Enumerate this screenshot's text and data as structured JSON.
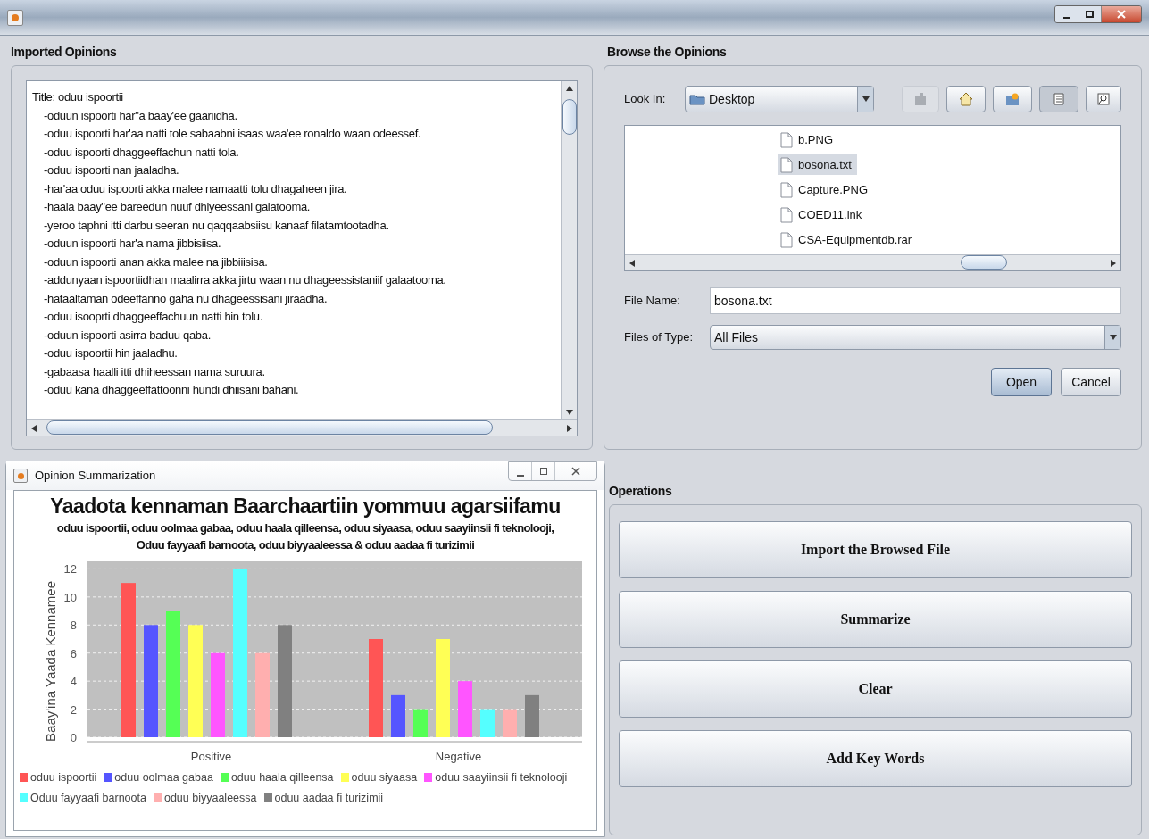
{
  "imported_opinions": {
    "title": "Imported Opinions",
    "heading": "Title: oduu ispoortii",
    "lines": [
      "-oduun ispoorti har\"a baay'ee gaariidha.",
      "-oduu ispoorti har'aa natti tole sabaabni isaas waa'ee ronaldo waan odeessef.",
      "-oduu ispoorti dhaggeeffachun natti tola.",
      "-oduu ispoorti nan jaaladha.",
      "-har'aa oduu ispoorti akka malee namaatti tolu dhagaheen jira.",
      "-haala baay\"ee bareedun nuuf dhiyeessani galatooma.",
      "-yeroo taphni itti darbu seeran nu qaqqaabsiisu kanaaf filatamtootadha.",
      "-oduun ispoorti har'a nama jibbisiisa.",
      "-oduun ispoorti anan akka malee na jibbiiisisa.",
      "-addunyaan ispoortiidhan maalirra akka jirtu waan nu dhageessistaniif galaatooma.",
      "-hataaltaman odeeffanno gaha nu dhageessisani jiraadha.",
      "-oduu isooprti dhaggeeffachuun natti hin tolu.",
      "-oduun ispoorti asirra baduu qaba.",
      "-oduu ispoortii hin jaaladhu.",
      "-gabaasa haalli itti dhiheessan nama suruura.",
      "-oduu kana dhaggeeffattoonni hundi dhiisani bahani."
    ]
  },
  "browser": {
    "title": "Browse the Opinions",
    "look_in_label": "Look In:",
    "look_in": "Desktop",
    "files": [
      {
        "name": "b.PNG",
        "selected": false
      },
      {
        "name": "bosona.txt",
        "selected": true
      },
      {
        "name": "Capture.PNG",
        "selected": false
      },
      {
        "name": "COED11.lnk",
        "selected": false
      },
      {
        "name": "CSA-Equipmentdb.rar",
        "selected": false
      }
    ],
    "file_name_label": "File Name:",
    "file_name": "bosona.txt",
    "file_type_label": "Files of Type:",
    "file_type": "All Files",
    "buttons": [
      "Open",
      "Cancel"
    ]
  },
  "summary_window": {
    "title": "Opinion Summarization",
    "subtitle_lines": [
      "oduu ispoortii, oduu oolmaa gabaa, oduu haala qilleensa, oduu siyaasa, oduu saayiinsii fi teknolooji,",
      "Oduu fayyaafi barnoota, oduu biyyaaleessa & oduu aadaa fi turizimii"
    ],
    "chart_data": {
      "type": "bar",
      "grid": true,
      "title": "Yaadota kennaman Baarchaartiin yommuu agarsiifamu",
      "ylabel": "Baay'ina Yaada Kennamee",
      "categories": [
        "Positive",
        "Negative"
      ],
      "ylim": [
        0,
        12.6
      ],
      "yticks": [
        0,
        2,
        4,
        6,
        8,
        10,
        12
      ],
      "series": [
        {
          "name": "oduu ispoortii",
          "color": "#ff5555",
          "values": [
            11,
            7
          ]
        },
        {
          "name": "oduu oolmaa gabaa",
          "color": "#5555ff",
          "values": [
            8,
            3
          ]
        },
        {
          "name": "oduu haala qilleensa",
          "color": "#55ff55",
          "values": [
            9,
            2
          ]
        },
        {
          "name": "oduu siyaasa",
          "color": "#ffff55",
          "values": [
            8,
            7
          ]
        },
        {
          "name": "oduu saayiinsii fi teknolooji",
          "color": "#ff55ff",
          "values": [
            6,
            4
          ]
        },
        {
          "name": "Oduu fayyaafi barnoota",
          "color": "#55ffff",
          "values": [
            12,
            2
          ]
        },
        {
          "name": "oduu biyyaaleessa",
          "color": "#ffafaf",
          "values": [
            6,
            2
          ]
        },
        {
          "name": "oduu aadaa fi turizimii",
          "color": "#808080",
          "values": [
            8,
            3
          ]
        }
      ]
    }
  },
  "operations": {
    "title": "Operations",
    "buttons": [
      "Import the Browsed File",
      "Summarize",
      "Clear",
      "Add Key Words"
    ]
  }
}
